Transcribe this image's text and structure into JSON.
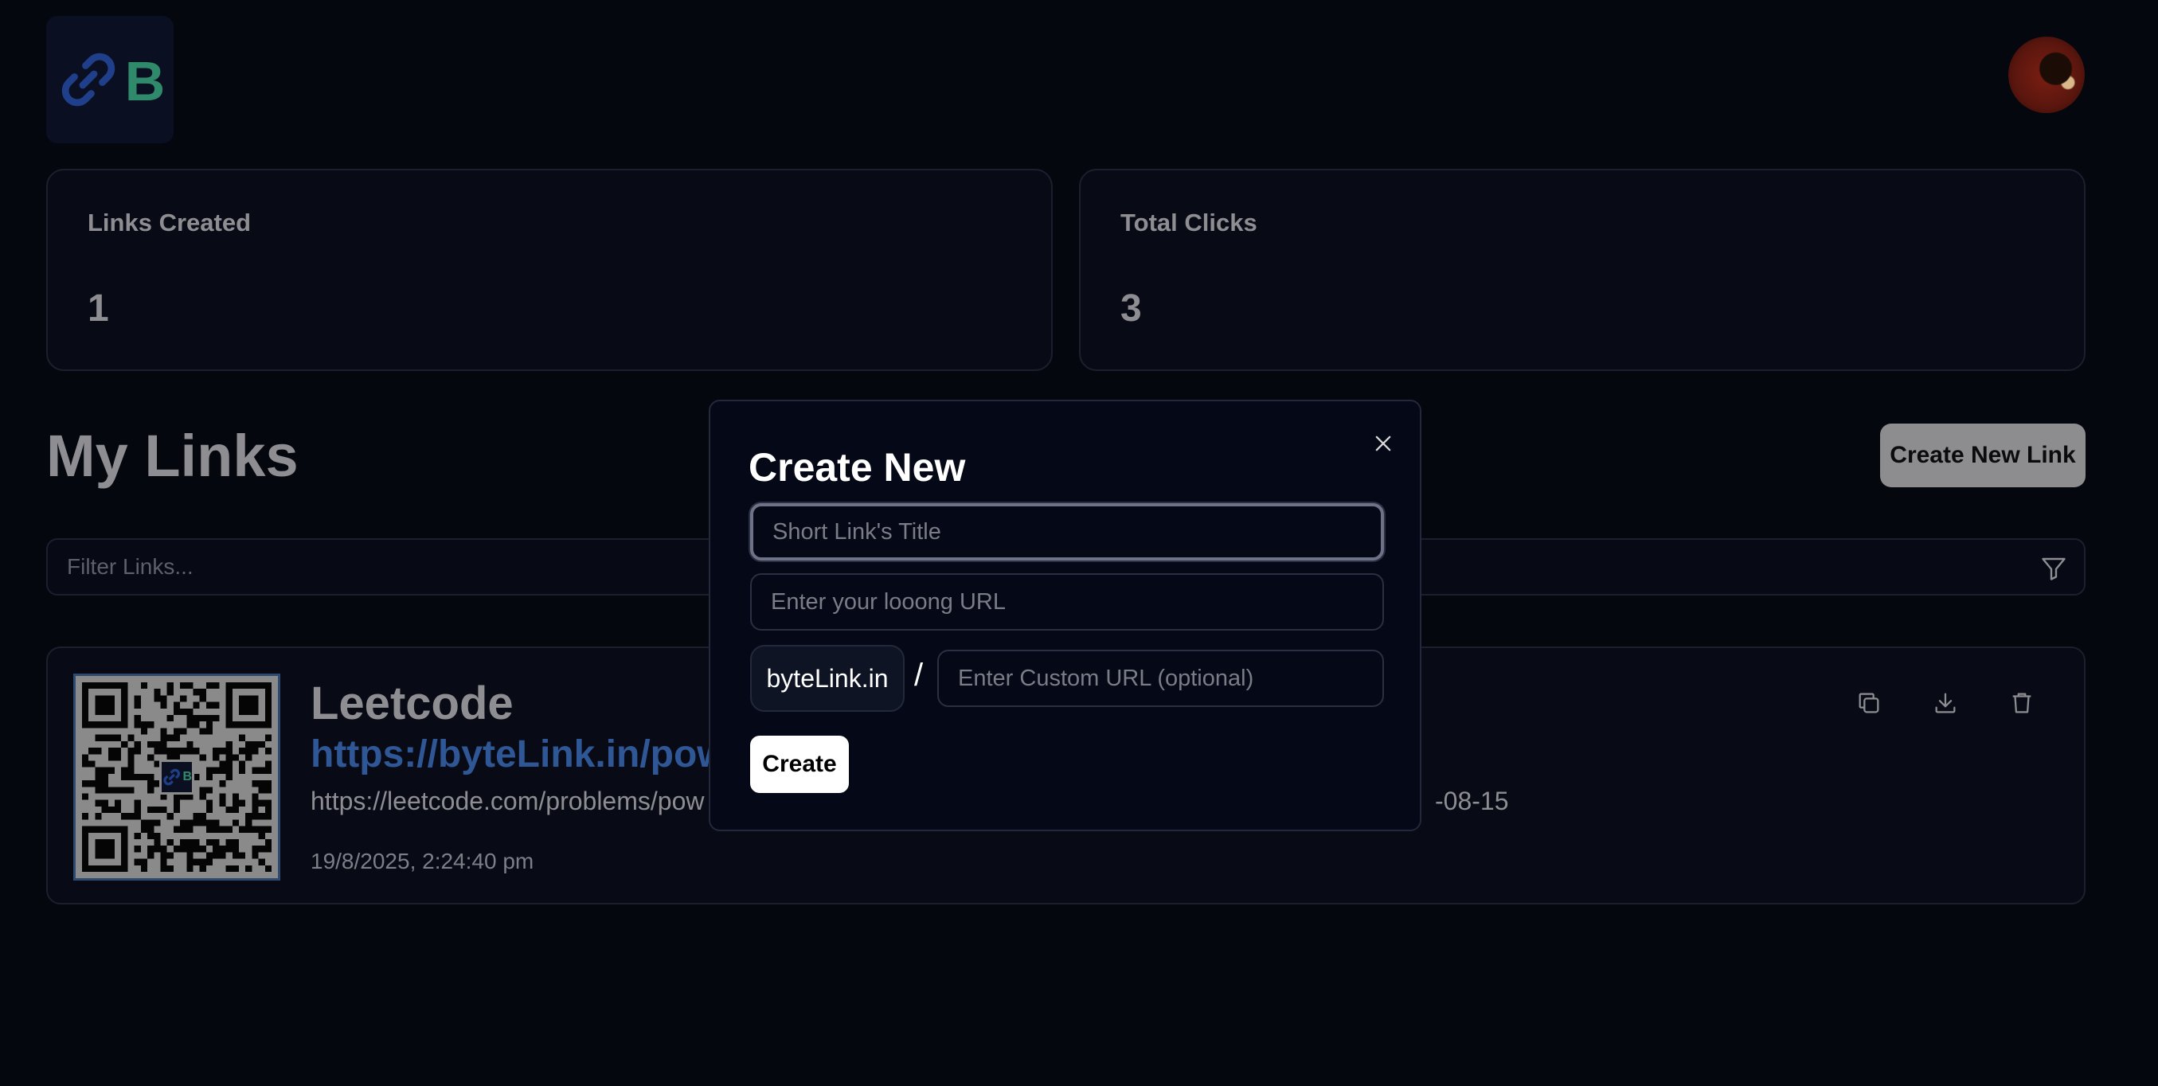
{
  "header": {
    "logo_letter": "B",
    "avatar_alt": "User avatar"
  },
  "stats": {
    "links_created_label": "Links Created",
    "links_created_value": "1",
    "total_clicks_label": "Total Clicks",
    "total_clicks_value": "3"
  },
  "links": {
    "section_title": "My Links",
    "create_button_label": "Create New Link",
    "filter_placeholder": "Filter Links...",
    "items": [
      {
        "title": "Leetcode",
        "short_url": "https://byteLink.in/pow",
        "original_url": "https://leetcode.com/problems/pow",
        "original_url_tail": "-08-15",
        "created_at": "19/8/2025, 2:24:40 pm"
      }
    ]
  },
  "modal": {
    "title": "Create New",
    "title_placeholder": "Short Link's Title",
    "url_placeholder": "Enter your looong URL",
    "domain": "byteLink.in",
    "separator": "/",
    "custom_placeholder": "Enter Custom URL (optional)",
    "create_label": "Create"
  },
  "colors": {
    "background": "#05070f",
    "accent_blue": "#2f5796",
    "logo_green": "#2f8a6c",
    "muted_text": "#8e8e92"
  }
}
